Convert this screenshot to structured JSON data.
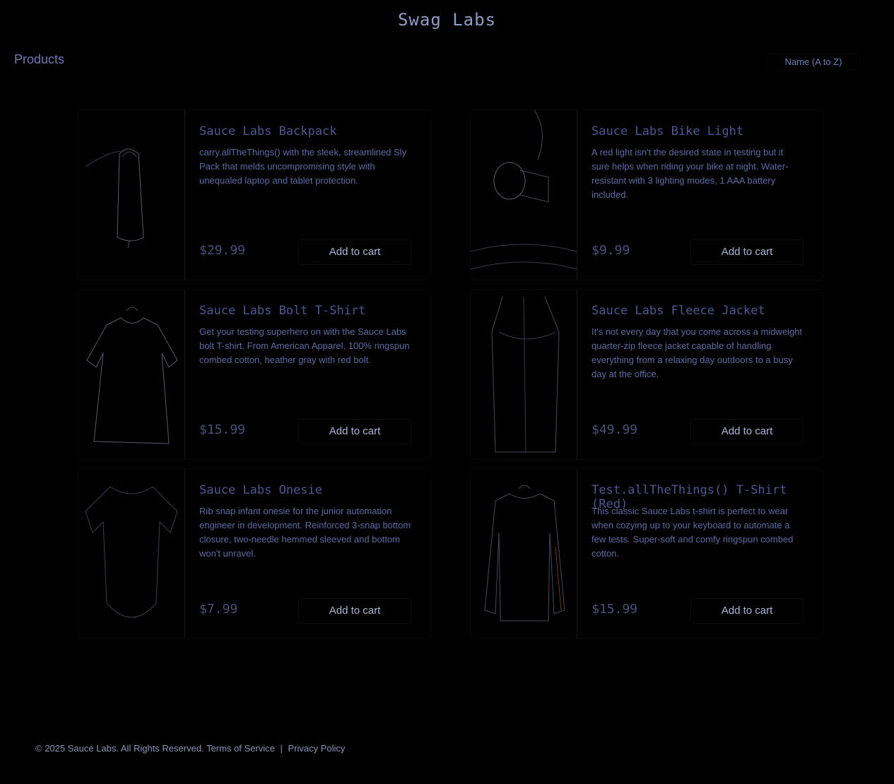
{
  "header": {
    "title": "Swag Labs"
  },
  "page": {
    "section_title": "Products",
    "sort_selected": "Name (A to Z)"
  },
  "products": [
    {
      "name": "Sauce Labs Backpack",
      "description": "carry.allTheThings() with the sleek, streamlined Sly Pack that melds uncompromising style with unequaled laptop and tablet protection.",
      "price": "$29.99",
      "button": "Add to cart",
      "image_icon": "backpack-icon"
    },
    {
      "name": "Sauce Labs Bike Light",
      "description": "A red light isn't the desired state in testing but it sure helps when riding your bike at night. Water-resistant with 3 lighting modes, 1 AAA battery included.",
      "price": "$9.99",
      "button": "Add to cart",
      "image_icon": "bike-light-icon"
    },
    {
      "name": "Sauce Labs Bolt T-Shirt",
      "description": "Get your testing superhero on with the Sauce Labs bolt T-shirt. From American Apparel, 100% ringspun combed cotton, heather gray with red bolt.",
      "price": "$15.99",
      "button": "Add to cart",
      "image_icon": "tshirt-icon"
    },
    {
      "name": "Sauce Labs Fleece Jacket",
      "description": "It's not every day that you come across a midweight quarter-zip fleece jacket capable of handling everything from a relaxing day outdoors to a busy day at the office.",
      "price": "$49.99",
      "button": "Add to cart",
      "image_icon": "jacket-icon"
    },
    {
      "name": "Sauce Labs Onesie",
      "description": "Rib snap infant onesie for the junior automation engineer in development. Reinforced 3-snap bottom closure, two-needle hemmed sleeved and bottom won't unravel.",
      "price": "$7.99",
      "button": "Add to cart",
      "image_icon": "onesie-icon"
    },
    {
      "name": "Test.allTheThings() T-Shirt (Red)",
      "description": "This classic Sauce Labs t-shirt is perfect to wear when cozying up to your keyboard to automate a few tests. Super-soft and comfy ringspun combed cotton.",
      "price": "$15.99",
      "button": "Add to cart",
      "image_icon": "long-sleeve-shirt-icon"
    }
  ],
  "footer": {
    "copyright": "© 2025 Sauce Labs. All Rights Reserved.",
    "terms": "Terms of Service",
    "separator": "|",
    "privacy": "Privacy Policy"
  }
}
